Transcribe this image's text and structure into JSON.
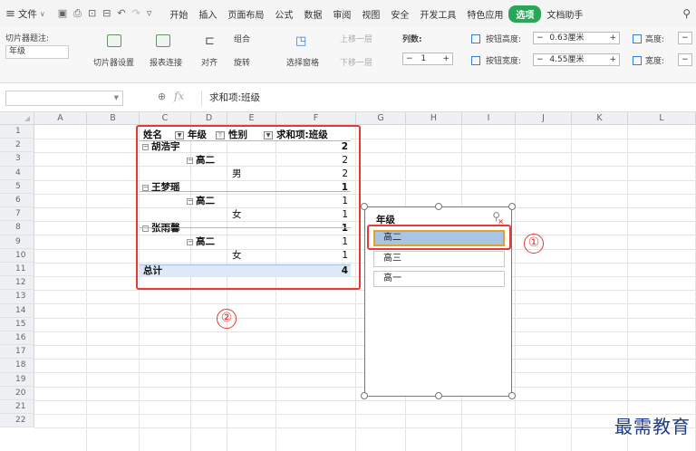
{
  "menubar": {
    "file_label": "文件",
    "tabs": [
      "开始",
      "插入",
      "页面布局",
      "公式",
      "数据",
      "审阅",
      "视图",
      "安全",
      "开发工具",
      "特色应用"
    ],
    "active_tab": "选项",
    "extra_tab": "文档助手"
  },
  "ribbon": {
    "caption_label": "切片器题注:",
    "caption_value": "年级",
    "slicer_settings": "切片器设置",
    "report_connections": "报表连接",
    "align": "对齐",
    "group": "组合",
    "rotate": "旋转",
    "selection_pane": "选择窗格",
    "bring_forward": "上移一层",
    "send_backward": "下移一层",
    "columns_label": "列数:",
    "columns_value": "1",
    "button_height_label": "按钮高度:",
    "button_height_value": "0.63厘米",
    "button_width_label": "按钮宽度:",
    "button_width_value": "4.55厘米",
    "height_label": "高度:",
    "width_label": "宽度:"
  },
  "formula_bar": {
    "name_box": "",
    "fx": "fx",
    "content": "求和项:班级"
  },
  "grid": {
    "columns": [
      "A",
      "B",
      "C",
      "D",
      "E",
      "F",
      "G",
      "H",
      "I",
      "J",
      "K",
      "L"
    ],
    "rows": [
      "1",
      "2",
      "3",
      "4",
      "5",
      "6",
      "7",
      "8",
      "9",
      "10",
      "11",
      "12",
      "13",
      "14",
      "15",
      "16",
      "17",
      "18",
      "19",
      "20",
      "21",
      "22"
    ]
  },
  "pivot": {
    "headers": {
      "name": "姓名",
      "grade": "年级",
      "gender": "性别",
      "sum": "求和项:班级"
    },
    "rows": [
      {
        "level": 0,
        "label": "胡浩宇",
        "value": "2"
      },
      {
        "level": 1,
        "label": "高二",
        "value": "2"
      },
      {
        "level": 2,
        "label": "男",
        "value": "2"
      },
      {
        "level": 0,
        "label": "王梦瑶",
        "value": "1"
      },
      {
        "level": 1,
        "label": "高二",
        "value": "1"
      },
      {
        "level": 2,
        "label": "女",
        "value": "1"
      },
      {
        "level": 0,
        "label": "张雨馨",
        "value": "1"
      },
      {
        "level": 1,
        "label": "高二",
        "value": "1"
      },
      {
        "level": 2,
        "label": "女",
        "value": "1"
      }
    ],
    "total_label": "总计",
    "total_value": "4"
  },
  "slicer": {
    "title": "年级",
    "items": [
      {
        "label": "高二",
        "selected": true
      },
      {
        "label": "高三",
        "selected": false
      },
      {
        "label": "高一",
        "selected": false
      }
    ]
  },
  "annotations": {
    "one": "①",
    "two": "②"
  },
  "watermark": "最需教育",
  "colors": {
    "accent_green": "#2aa55a",
    "annotation_red": "#e53935",
    "slicer_selected": "#a9c5e6",
    "selected_border": "#e0a22a"
  }
}
